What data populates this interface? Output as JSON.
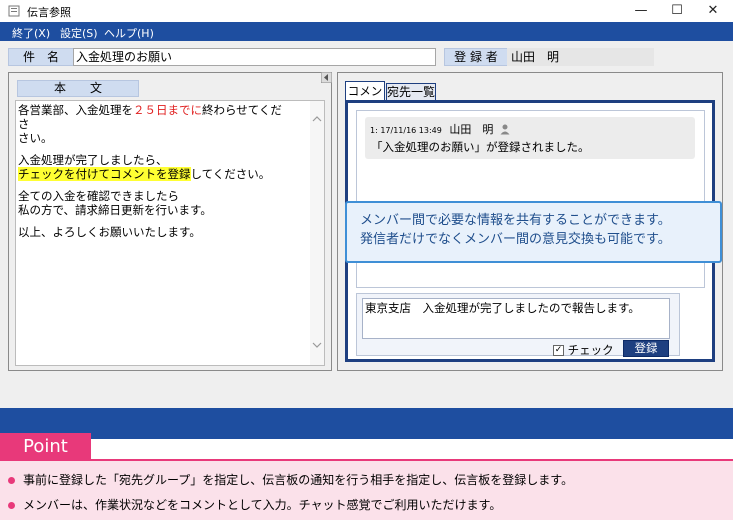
{
  "window": {
    "title": "伝言参照",
    "minimize": "—",
    "maximize": "☐",
    "close": "✕"
  },
  "menu": [
    {
      "label": "終了(X)"
    },
    {
      "label": "設定(S)"
    },
    {
      "label": "ヘルプ(H)"
    }
  ],
  "header": {
    "subject_label": "件　名",
    "subject_value": "入金処理のお願い",
    "registrant_label": "登 録 者",
    "registrant_value": "山田　明"
  },
  "body_panel": {
    "label": "本　　文",
    "lines": {
      "l1_pre": "各営業部、入金処理を",
      "l1_red": "２５日までに",
      "l1_post": "終わらせてくださ",
      "l2": "さい。",
      "l3": "入金処理が完了しましたら、",
      "l4_yellow": "チェックを付けてコメントを登録",
      "l4_post": "してください。",
      "l5": "全ての入金を確認できましたら",
      "l6": "私の方で、請求締日更新を行います。",
      "l7": "以上、よろしくお願いいたします。"
    }
  },
  "tabs": [
    {
      "label": "コメント"
    },
    {
      "label": "宛先一覧"
    }
  ],
  "comment": {
    "meta": "1: 17/11/16 13:49",
    "author": "山田　明",
    "text": "「入金処理のお願い」が登録されました。"
  },
  "callout": {
    "line1": "メンバー間で必要な情報を共有することができます。",
    "line2": "発信者だけでなくメンバー間の意見交換も可能です。"
  },
  "reply": {
    "text": "東京支店　入金処理が完了しましたので報告します。",
    "check_label": "チェック",
    "checked": true,
    "submit_label": "登録"
  },
  "point": {
    "title": "Point",
    "bullets": [
      "事前に登録した「宛先グループ」を指定し、伝言板の通知を行う相手を指定し、伝言板を登録します。",
      "メンバーは、作業状況などをコメントとして入力。チャット感覚でご利用いただけます。"
    ]
  }
}
